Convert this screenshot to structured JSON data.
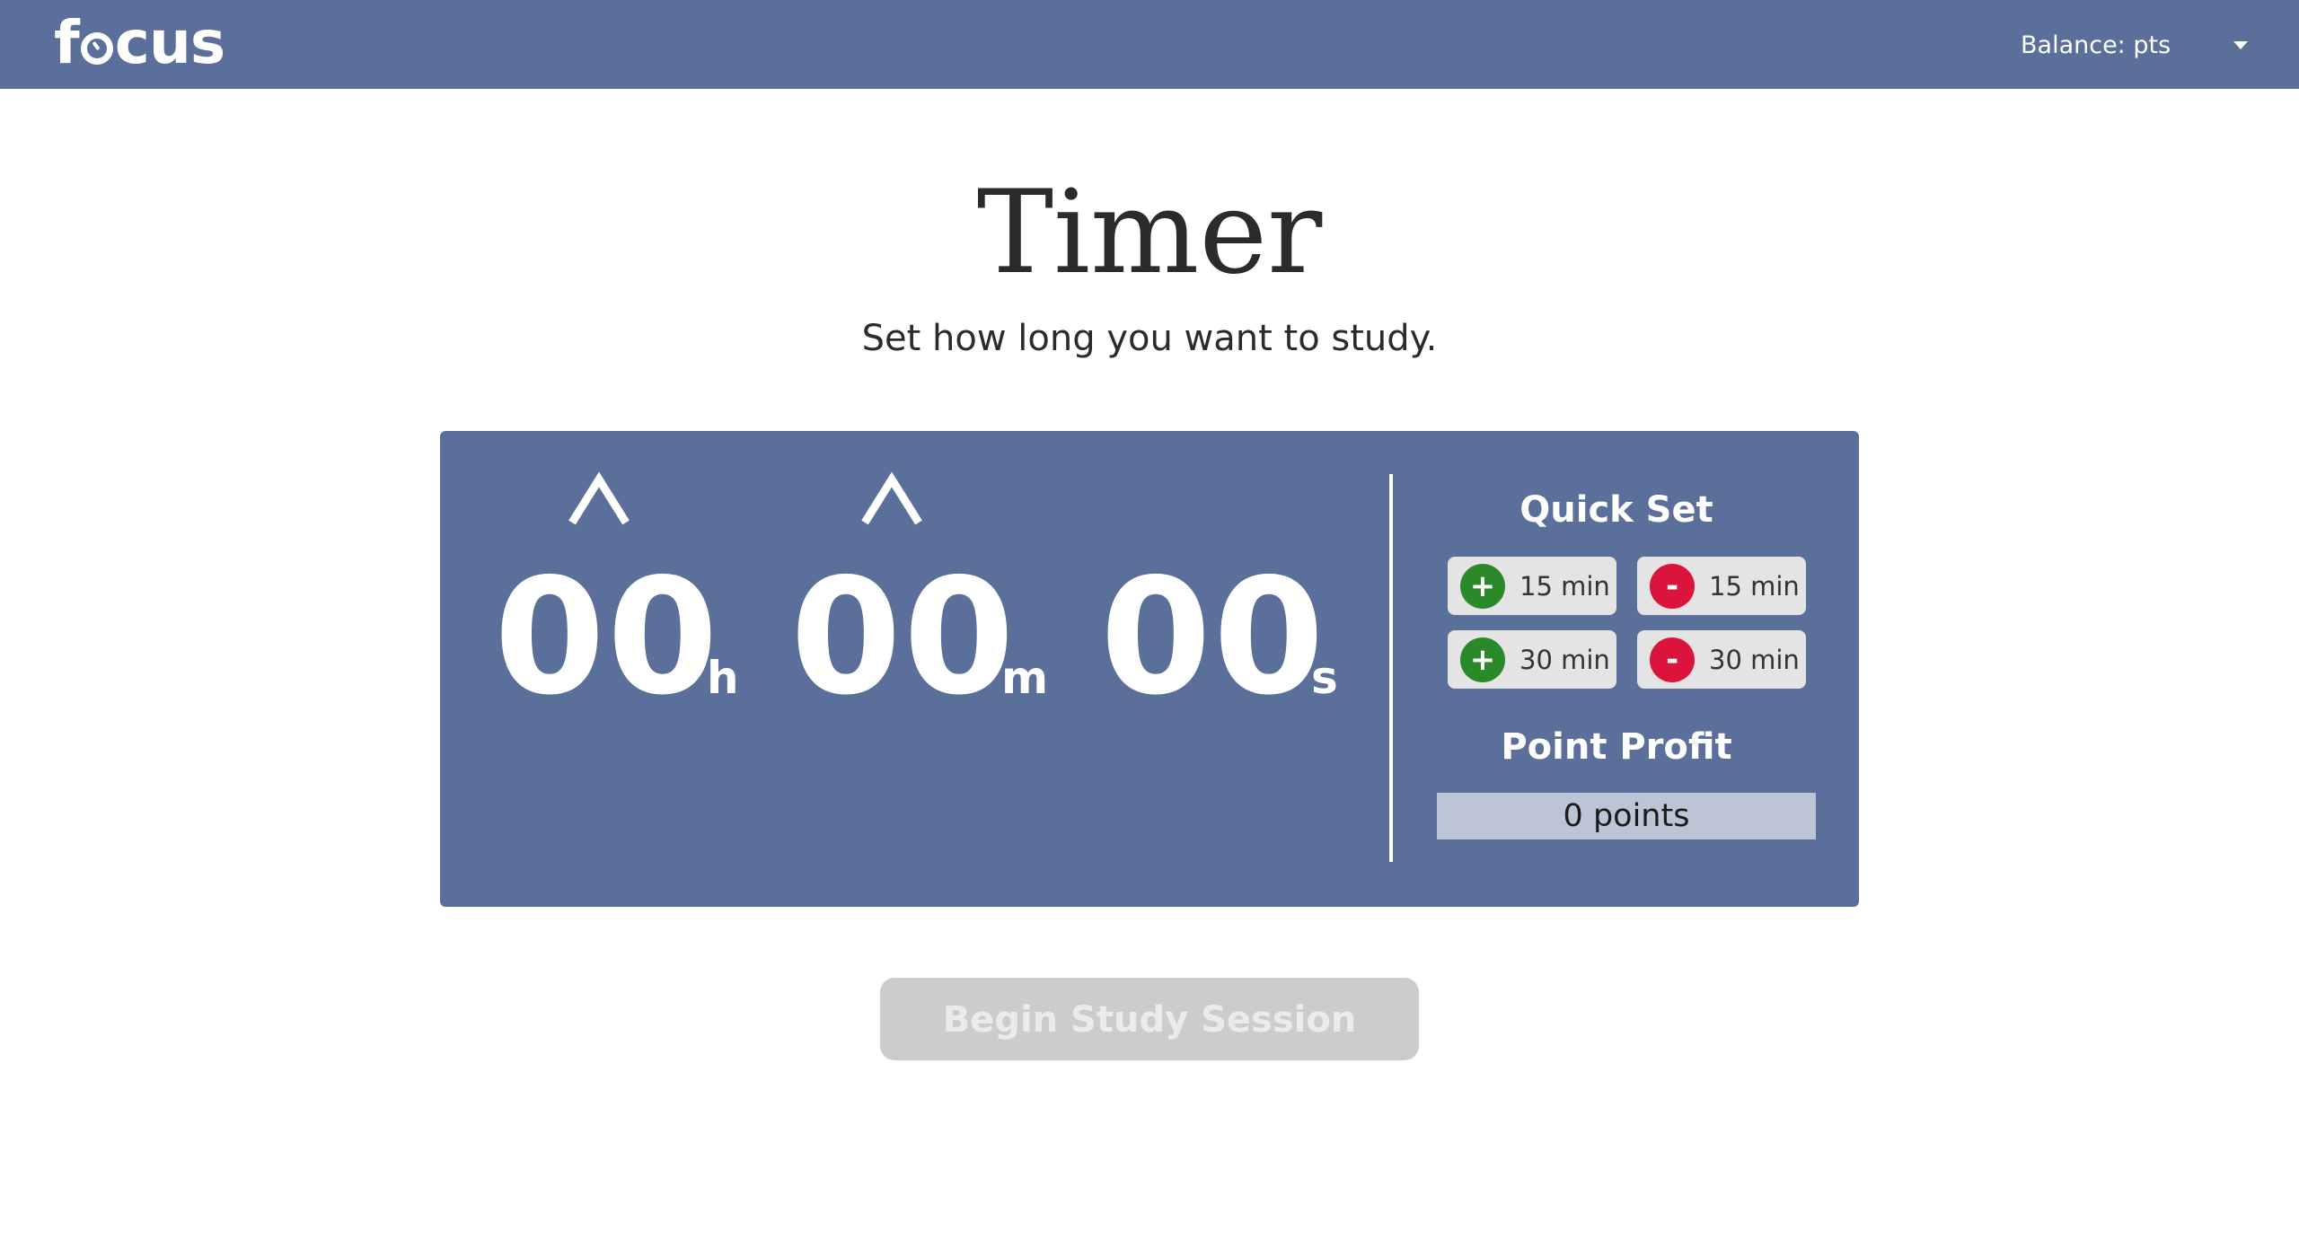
{
  "navbar": {
    "brand": {
      "prefix": "f",
      "suffix": "cus",
      "icon": "clock-icon"
    },
    "balance_label": "Balance: pts",
    "dropdown_icon": "caret-down-icon"
  },
  "header": {
    "title": "Timer",
    "subtitle": "Set how long you want to study."
  },
  "timer": {
    "hours": "00",
    "hours_unit": "h",
    "minutes": "00",
    "minutes_unit": "m",
    "seconds": "00",
    "seconds_unit": "s",
    "increment_icon": "chevron-up-icon"
  },
  "quick_set": {
    "title": "Quick Set",
    "buttons": [
      {
        "sign": "+",
        "label": "15 min",
        "color": "#2a8a2a"
      },
      {
        "sign": "-",
        "label": "15 min",
        "color": "#dc143c"
      },
      {
        "sign": "+",
        "label": "30 min",
        "color": "#2a8a2a"
      },
      {
        "sign": "-",
        "label": "30 min",
        "color": "#dc143c"
      }
    ]
  },
  "point_profit": {
    "title": "Point Profit",
    "value": "0 points"
  },
  "begin_button": {
    "label": "Begin Study Session",
    "state": "disabled"
  },
  "colors": {
    "primary": "#5b6f9b",
    "add": "#2a8a2a",
    "subtract": "#dc143c",
    "disabled_button": "#cccccc"
  }
}
